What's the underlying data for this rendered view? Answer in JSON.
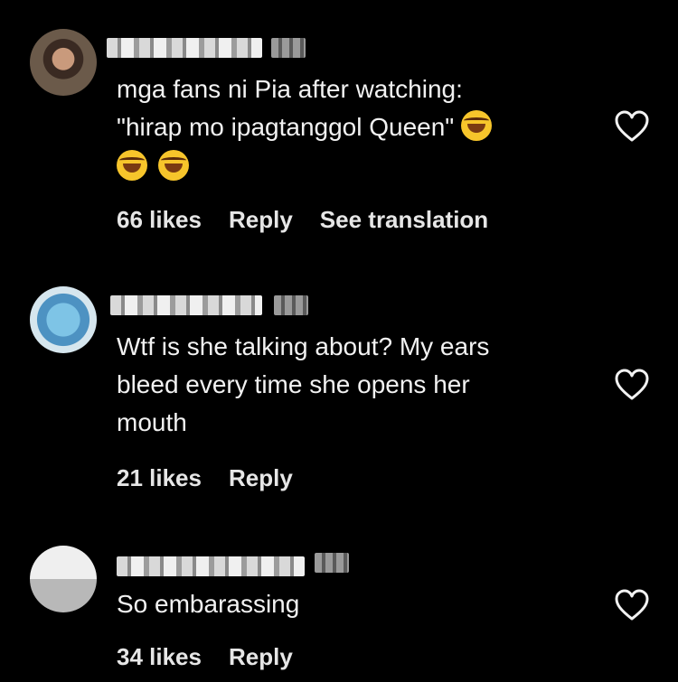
{
  "comments": [
    {
      "text_line1": "mga fans ni Pia after watching:",
      "text_line2": "\"hirap mo ipagtanggol Queen\"",
      "likes": "66 likes",
      "reply": "Reply",
      "translate": "See translation",
      "emoji": "face-with-tears-of-joy"
    },
    {
      "text": "Wtf is she talking about? My ears\nbleed every time she opens her\nmouth",
      "likes": "21 likes",
      "reply": "Reply"
    },
    {
      "text": "So embarassing",
      "likes": "34 likes",
      "reply": "Reply"
    }
  ],
  "icons": {
    "like": "heart-outline-icon"
  },
  "colors": {
    "background": "#000000",
    "text": "#f2f2f2"
  }
}
